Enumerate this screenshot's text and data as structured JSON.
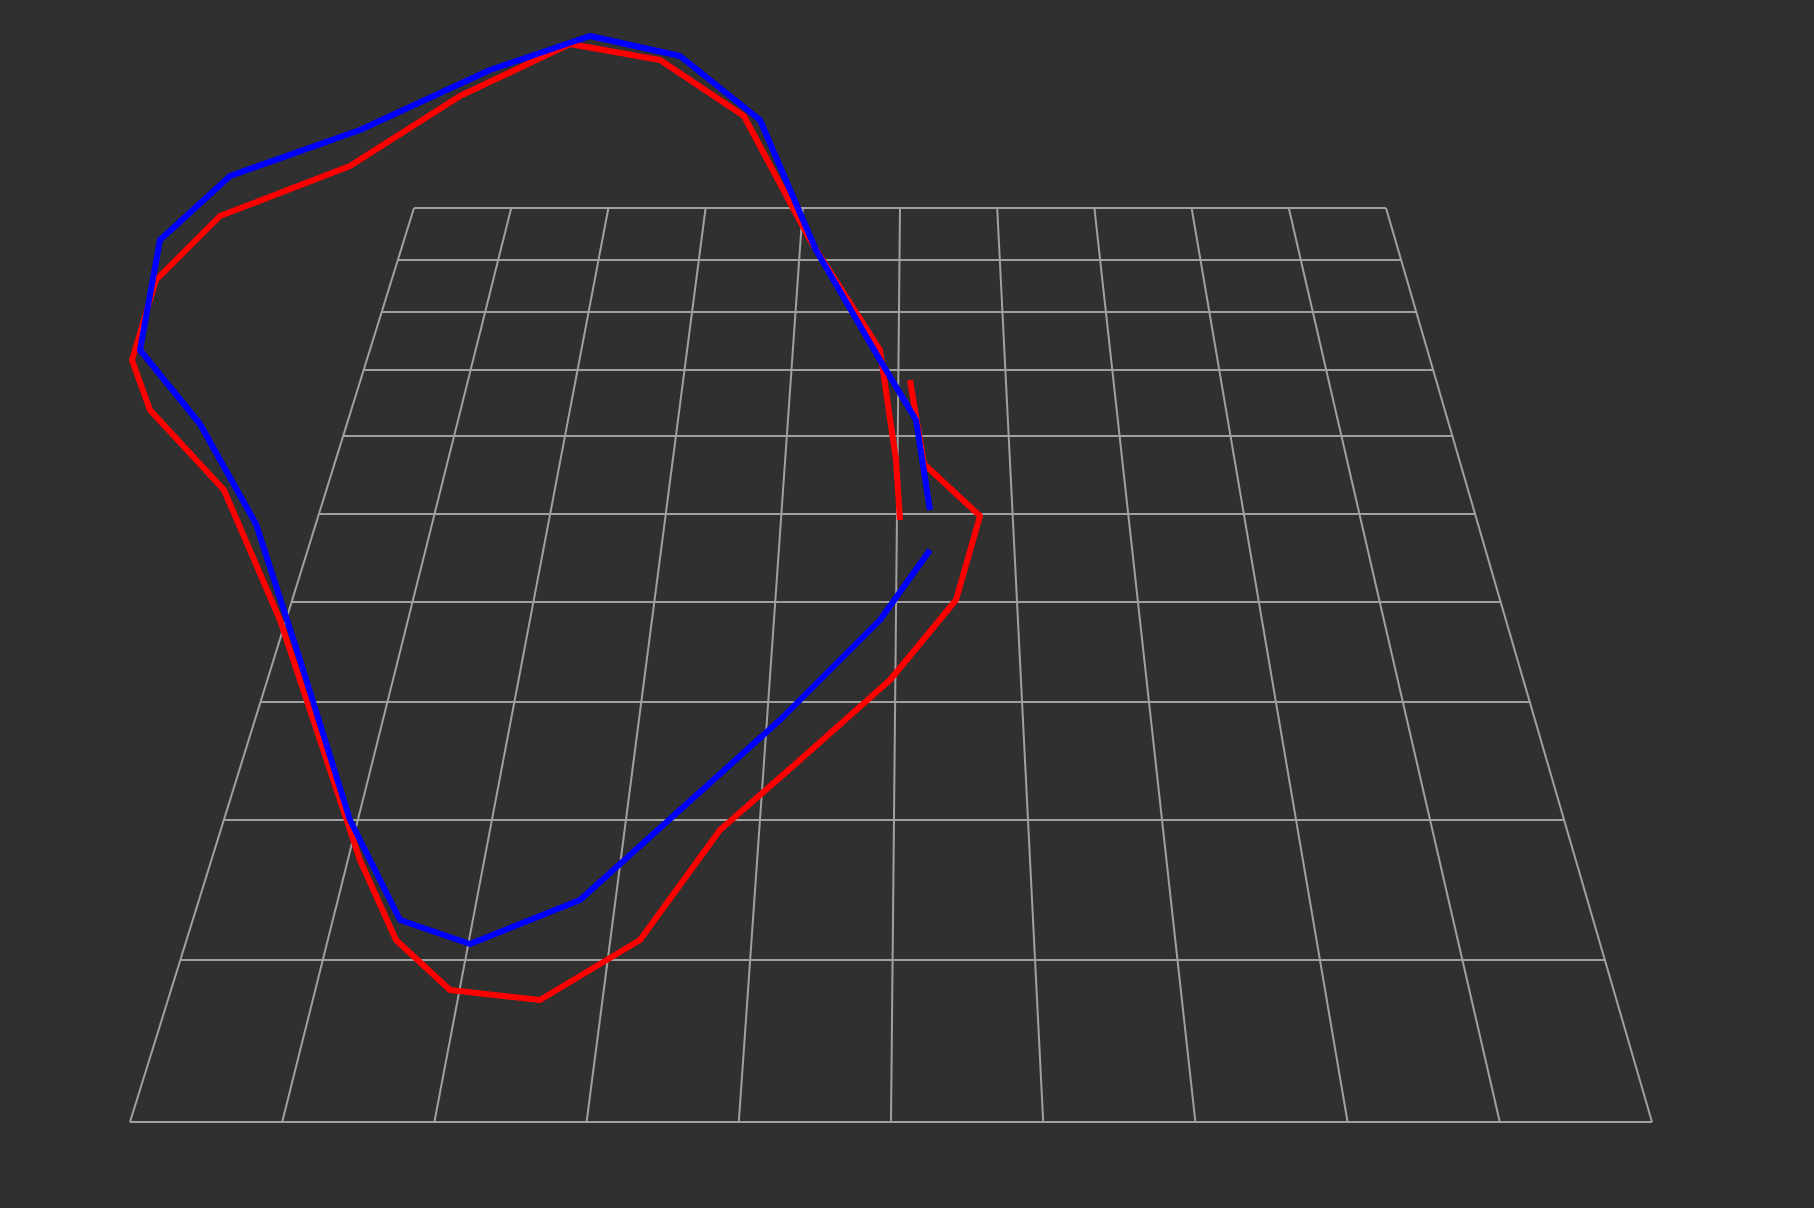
{
  "view": {
    "paths": [
      {
        "color": "#ff0000"
      },
      {
        "color": "#0000ff"
      }
    ]
  }
}
